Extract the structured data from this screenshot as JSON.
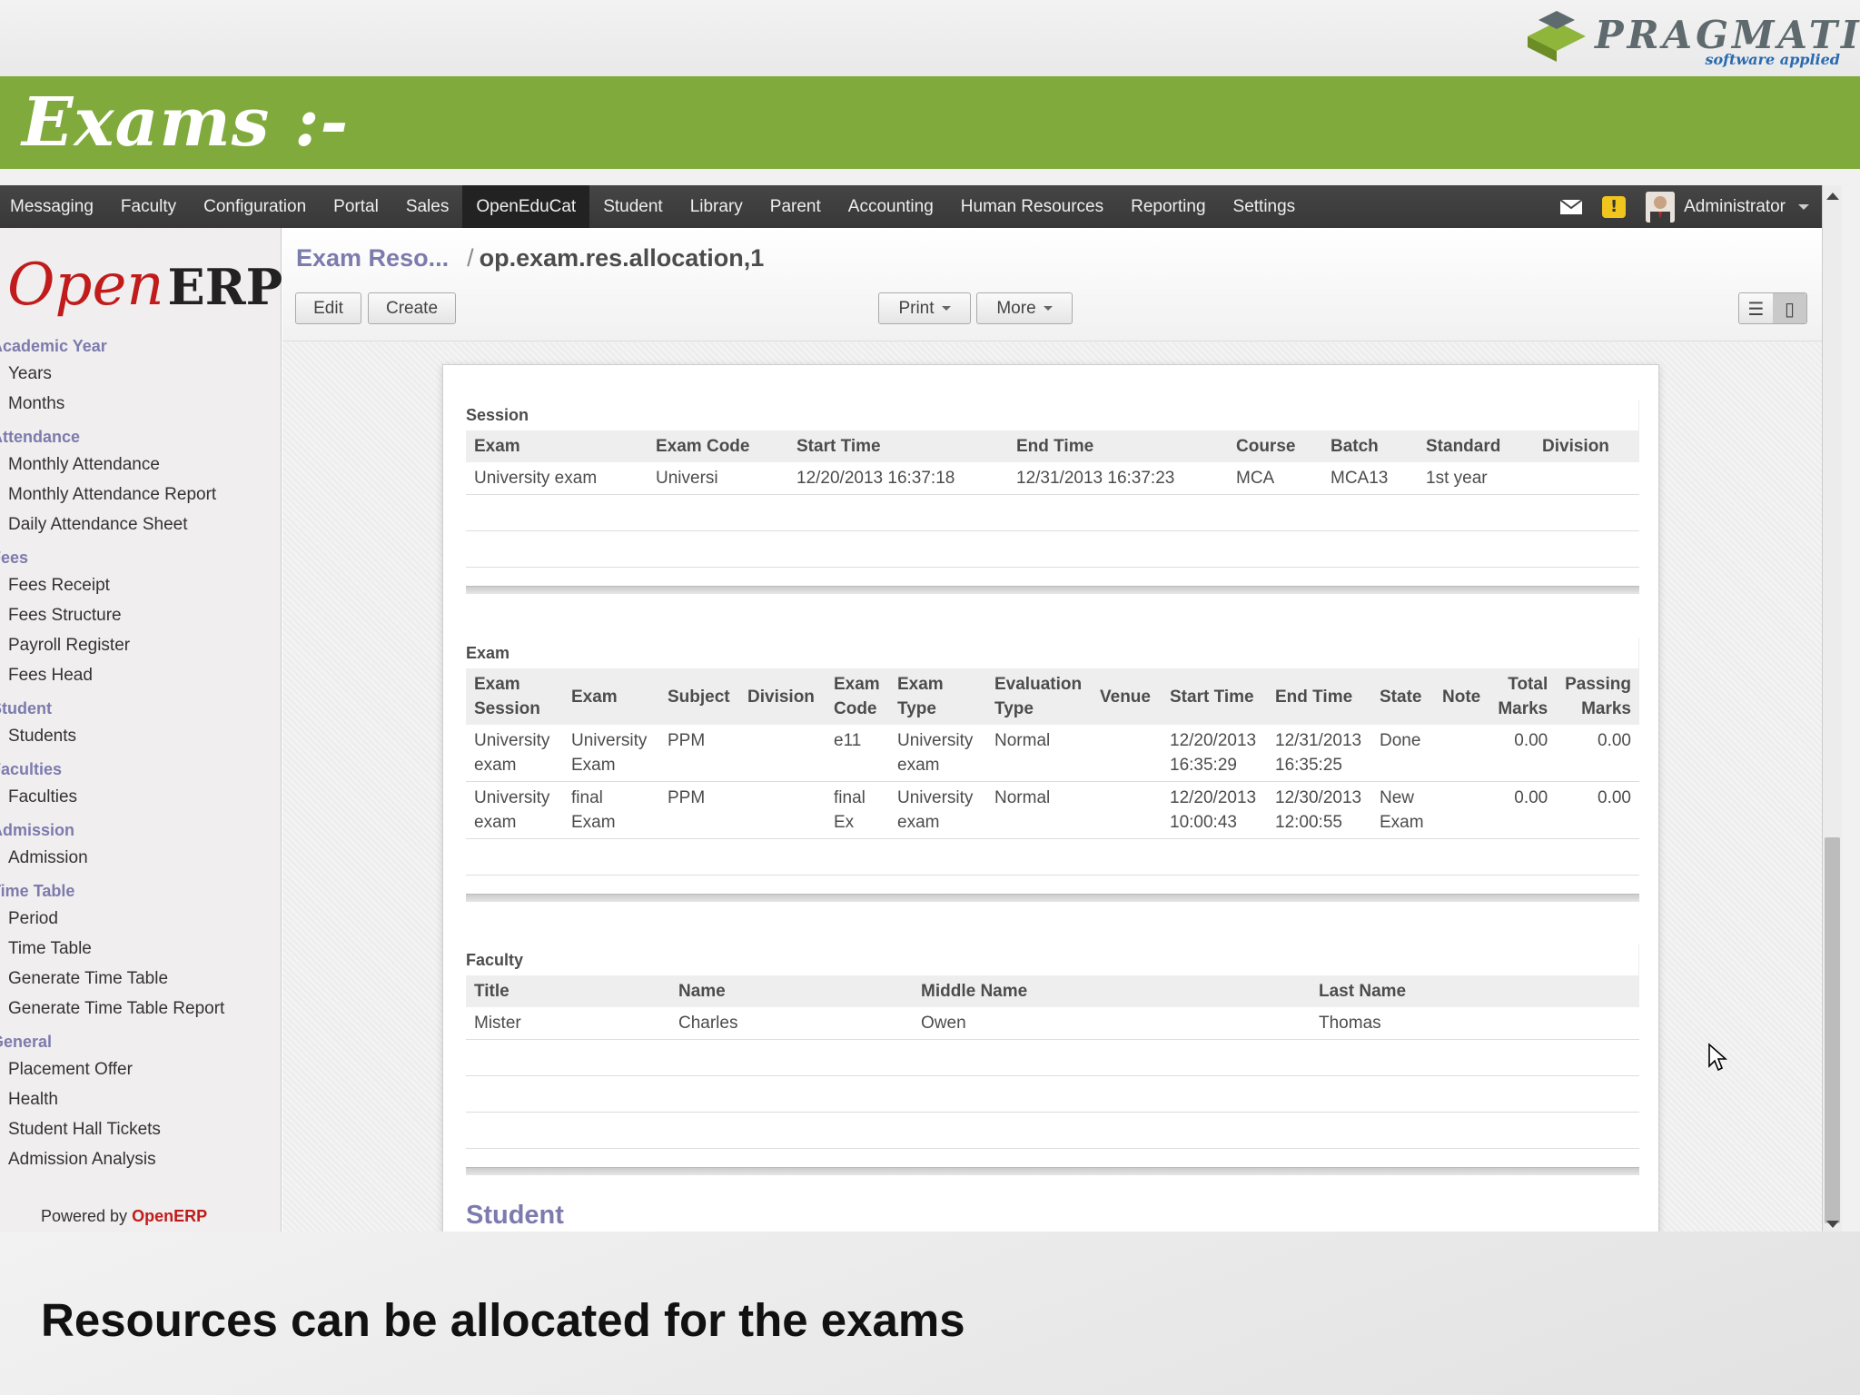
{
  "slide": {
    "brand_name": "PRAGMATIC",
    "brand_tagline": "software applied",
    "title": "Exams :-",
    "caption": "Resources can be allocated for the exams"
  },
  "topmenu": [
    "Messaging",
    "Faculty",
    "Configuration",
    "Portal",
    "Sales",
    "OpenEduCat",
    "Student",
    "Library",
    "Parent",
    "Accounting",
    "Human Resources",
    "Reporting",
    "Settings"
  ],
  "topmenu_active": "OpenEduCat",
  "user": {
    "name": "Administrator",
    "warning_glyph": "!"
  },
  "sidebar": {
    "logo_open": "Open",
    "logo_erp": "ERP",
    "sections": [
      {
        "title": "Academic Year",
        "items": [
          "Years",
          "Months"
        ]
      },
      {
        "title": "Attendance",
        "items": [
          "Monthly Attendance",
          "Monthly Attendance Report",
          "Daily Attendance Sheet"
        ]
      },
      {
        "title": "Fees",
        "items": [
          "Fees Receipt",
          "Fees Structure",
          "Payroll Register",
          "Fees Head"
        ]
      },
      {
        "title": "Student",
        "items": [
          "Students"
        ]
      },
      {
        "title": "Faculties",
        "items": [
          "Faculties"
        ]
      },
      {
        "title": "Admission",
        "items": [
          "Admission"
        ]
      },
      {
        "title": "Time Table",
        "items": [
          "Period",
          "Time Table",
          "Generate Time Table",
          "Generate Time Table Report"
        ]
      },
      {
        "title": "General",
        "items": [
          "Placement Offer",
          "Health",
          "Student Hall Tickets",
          "Admission Analysis"
        ]
      }
    ],
    "powered_prefix": "Powered by",
    "powered_brand": "OpenERP"
  },
  "breadcrumb": {
    "parent": "Exam Reso...",
    "separator": "/",
    "current": "op.exam.res.allocation,1"
  },
  "buttons": {
    "edit": "Edit",
    "create": "Create",
    "print": "Print",
    "more": "More"
  },
  "session": {
    "label": "Session",
    "columns": [
      "Exam",
      "Exam Code",
      "Start Time",
      "End Time",
      "Course",
      "Batch",
      "Standard",
      "Division"
    ],
    "rows": [
      [
        "University exam",
        "Universi",
        "12/20/2013 16:37:18",
        "12/31/2013 16:37:23",
        "MCA",
        "MCA13",
        "1st year",
        ""
      ]
    ]
  },
  "exam": {
    "label": "Exam",
    "columns": [
      "Exam Session",
      "Exam",
      "Subject",
      "Division",
      "Exam Code",
      "Exam Type",
      "Evaluation Type",
      "Venue",
      "Start Time",
      "End Time",
      "State",
      "Note",
      "Total Marks",
      "Passing Marks"
    ],
    "rows": [
      [
        "University exam",
        "University Exam",
        "PPM",
        "",
        "e11",
        "University exam",
        "Normal",
        "",
        "12/20/2013 16:35:29",
        "12/31/2013 16:35:25",
        "Done",
        "",
        "0.00",
        "0.00"
      ],
      [
        "University exam",
        "final Exam",
        "PPM",
        "",
        "final Ex",
        "University exam",
        "Normal",
        "",
        "12/20/2013 10:00:43",
        "12/30/2013 12:00:55",
        "New Exam",
        "",
        "0.00",
        "0.00"
      ]
    ]
  },
  "faculty": {
    "label": "Faculty",
    "columns": [
      "Title",
      "Name",
      "Middle Name",
      "Last Name"
    ],
    "rows": [
      [
        "Mister",
        "Charles",
        "Owen",
        "Thomas"
      ]
    ]
  },
  "student_label": "Student",
  "colors": {
    "accent_green": "#80ab3c",
    "link_purple": "#7c7bad",
    "openerp_red": "#c11b1b"
  }
}
